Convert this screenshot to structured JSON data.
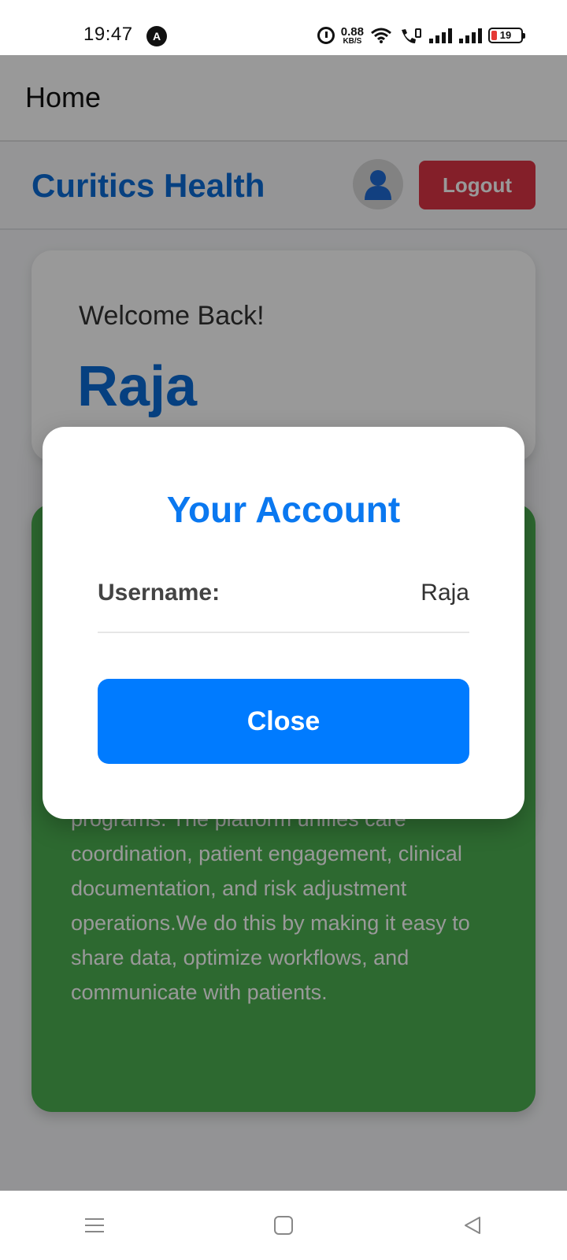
{
  "status_bar": {
    "time": "19:47",
    "net_speed_value": "0.88",
    "net_speed_unit": "KB/S",
    "battery_level": "19",
    "icons": [
      "app-a-icon",
      "alarm-icon",
      "wifi-icon",
      "volte-call-icon",
      "signal-icon",
      "signal-icon",
      "battery-icon"
    ]
  },
  "appbar": {
    "title": "Home"
  },
  "header": {
    "brand": "Curitics Health",
    "avatar_icon": "user-icon",
    "logout_label": "Logout"
  },
  "welcome": {
    "greeting": "Welcome Back!",
    "name": "Raja"
  },
  "about": {
    "text": "programs. The platform unifies care coordination, patient engagement, clinical documentation, and risk adjustment operations.We do this by making it easy to share data, optimize workflows, and communicate with patients."
  },
  "modal": {
    "title": "Your Account",
    "username_label": "Username:",
    "username_value": "Raja",
    "close_label": "Close"
  },
  "nav_bar": {
    "icons": [
      "menu-icon",
      "home-square-icon",
      "back-triangle-icon"
    ]
  },
  "colors": {
    "brand_blue": "#0a6cd6",
    "primary_button": "#007bff",
    "logout_red": "#dc3545",
    "card_green": "#4caf50"
  }
}
